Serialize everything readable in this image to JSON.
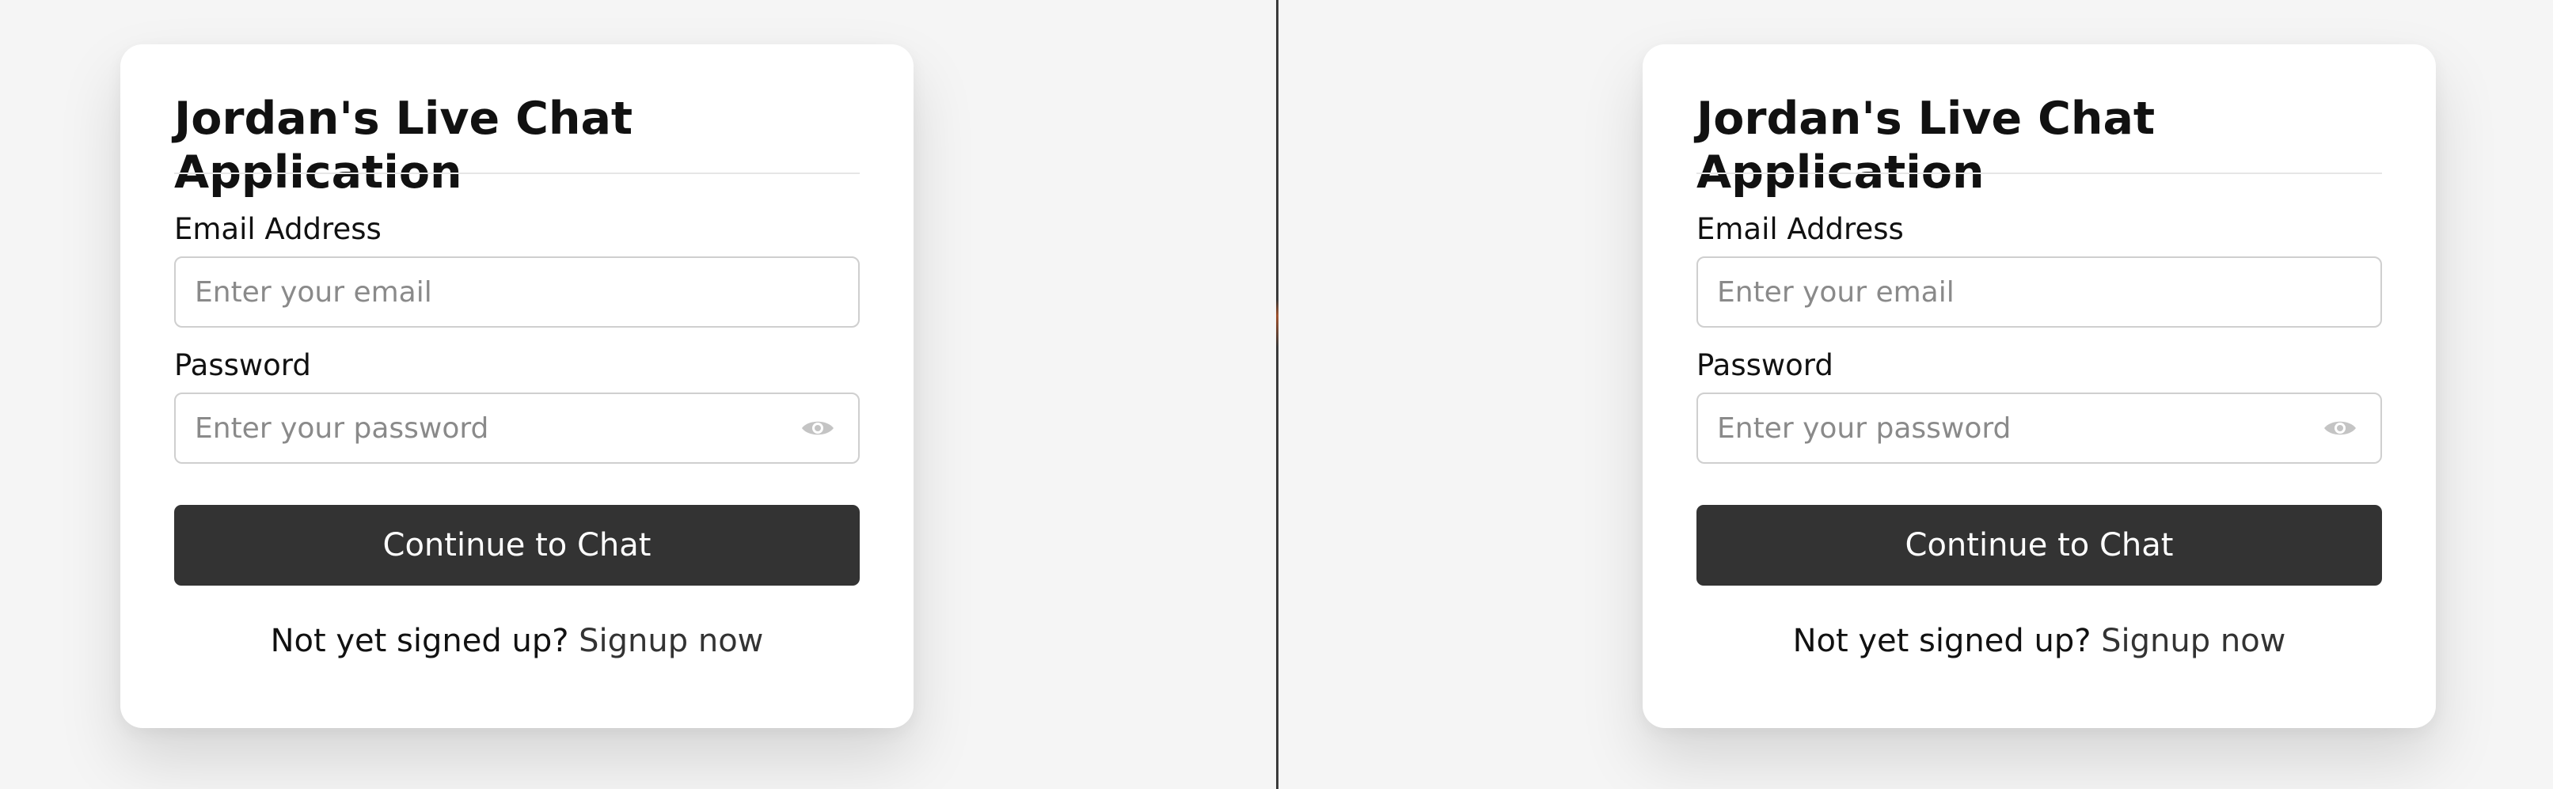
{
  "panes": [
    {
      "title": "Jordan's Live Chat Application",
      "email_label": "Email Address",
      "email_placeholder": "Enter your email",
      "password_label": "Password",
      "password_placeholder": "Enter your password",
      "submit_label": "Continue to Chat",
      "signup_prompt": "Not yet signed up?",
      "signup_link": "Signup now"
    },
    {
      "title": "Jordan's Live Chat Application",
      "email_label": "Email Address",
      "email_placeholder": "Enter your email",
      "password_label": "Password",
      "password_placeholder": "Enter your password",
      "submit_label": "Continue to Chat",
      "signup_prompt": "Not yet signed up?",
      "signup_link": "Signup now"
    }
  ],
  "icons": {
    "password_toggle": "eye-icon"
  },
  "colors": {
    "button_bg": "#333333",
    "button_text": "#ffffff",
    "page_bg": "#f5f5f5",
    "card_bg": "#ffffff"
  }
}
